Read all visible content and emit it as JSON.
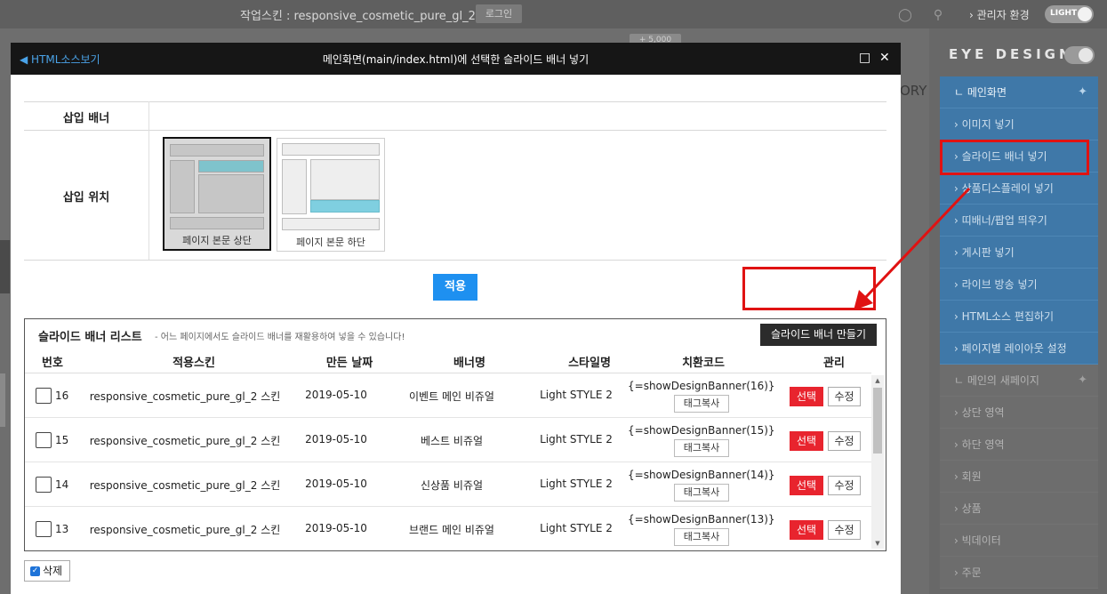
{
  "topbar": {
    "skin_label": "작업스킨 : responsive_cosmetic_pure_gl_2",
    "login": "로그인",
    "admin_env": "› 관리자 환경",
    "theme_toggle": "LIGHT"
  },
  "background": {
    "counter": "+ 5,000",
    "ory_text": "ORY"
  },
  "sidebar": {
    "brand": "EYE DESIGN",
    "main_section": "ㄴ 메인화면",
    "items": [
      {
        "label": "› 이미지 넣기"
      },
      {
        "label": "› 슬라이드 배너 넣기"
      },
      {
        "label": "› 상품디스플레이 넣기"
      },
      {
        "label": "› 띠배너/팝업 띄우기"
      },
      {
        "label": "› 게시판 넣기"
      },
      {
        "label": "› 라이브 방송 넣기"
      },
      {
        "label": "› HTML소스 편집하기"
      },
      {
        "label": "› 페이지별 레이아웃 설정"
      }
    ],
    "gray_items": [
      {
        "label": "ㄴ 메인의 새페이지"
      },
      {
        "label": "› 상단 영역"
      },
      {
        "label": "› 하단 영역"
      },
      {
        "label": "› 회원"
      },
      {
        "label": "› 상품"
      },
      {
        "label": "› 빅데이터"
      },
      {
        "label": "› 주문"
      }
    ]
  },
  "modal": {
    "html_source_link": "◀ HTML소스보기",
    "title": "메인화면(main/index.html)에 선택한 슬라이드 배너 넣기",
    "insert_banner_label": "삽입 배너",
    "insert_position_label": "삽입 위치",
    "positions": [
      {
        "caption": "페이지 본문 상단",
        "selected": true
      },
      {
        "caption": "페이지 본문 하단",
        "selected": false
      }
    ],
    "apply": "적용",
    "list": {
      "title": "슬라이드 배너 리스트",
      "description": "- 어느 페이지에서도 슬라이드 배너를 재활용하여 넣을 수 있습니다!",
      "make_button": "슬라이드 배너 만들기",
      "columns": [
        "번호",
        "적용스킨",
        "만든 날짜",
        "배너명",
        "스타일명",
        "치환코드",
        "관리"
      ],
      "rows": [
        {
          "num": "16",
          "skin": "responsive_cosmetic_pure_gl_2 스킨",
          "date": "2019-05-10",
          "name": "이벤트 메인 비쥬얼",
          "style": "Light STYLE 2",
          "code": "{=showDesignBanner(16)}",
          "tag": "태그복사",
          "select": "선택",
          "edit": "수정"
        },
        {
          "num": "15",
          "skin": "responsive_cosmetic_pure_gl_2 스킨",
          "date": "2019-05-10",
          "name": "베스트 비쥬얼",
          "style": "Light STYLE 2",
          "code": "{=showDesignBanner(15)}",
          "tag": "태그복사",
          "select": "선택",
          "edit": "수정"
        },
        {
          "num": "14",
          "skin": "responsive_cosmetic_pure_gl_2 스킨",
          "date": "2019-05-10",
          "name": "신상품 비쥬얼",
          "style": "Light STYLE 2",
          "code": "{=showDesignBanner(14)}",
          "tag": "태그복사",
          "select": "선택",
          "edit": "수정"
        },
        {
          "num": "13",
          "skin": "responsive_cosmetic_pure_gl_2 스킨",
          "date": "2019-05-10",
          "name": "브랜드 메인 비쥬얼",
          "style": "Light STYLE 2",
          "code": "{=showDesignBanner(13)}",
          "tag": "태그복사",
          "select": "선택",
          "edit": "수정"
        }
      ]
    },
    "delete": "삭제"
  },
  "colors": {
    "accent_blue": "#1e90f0",
    "select_red": "#e8242e",
    "highlight_red": "#e01212",
    "sidebar_blue": "#3f78a8"
  }
}
